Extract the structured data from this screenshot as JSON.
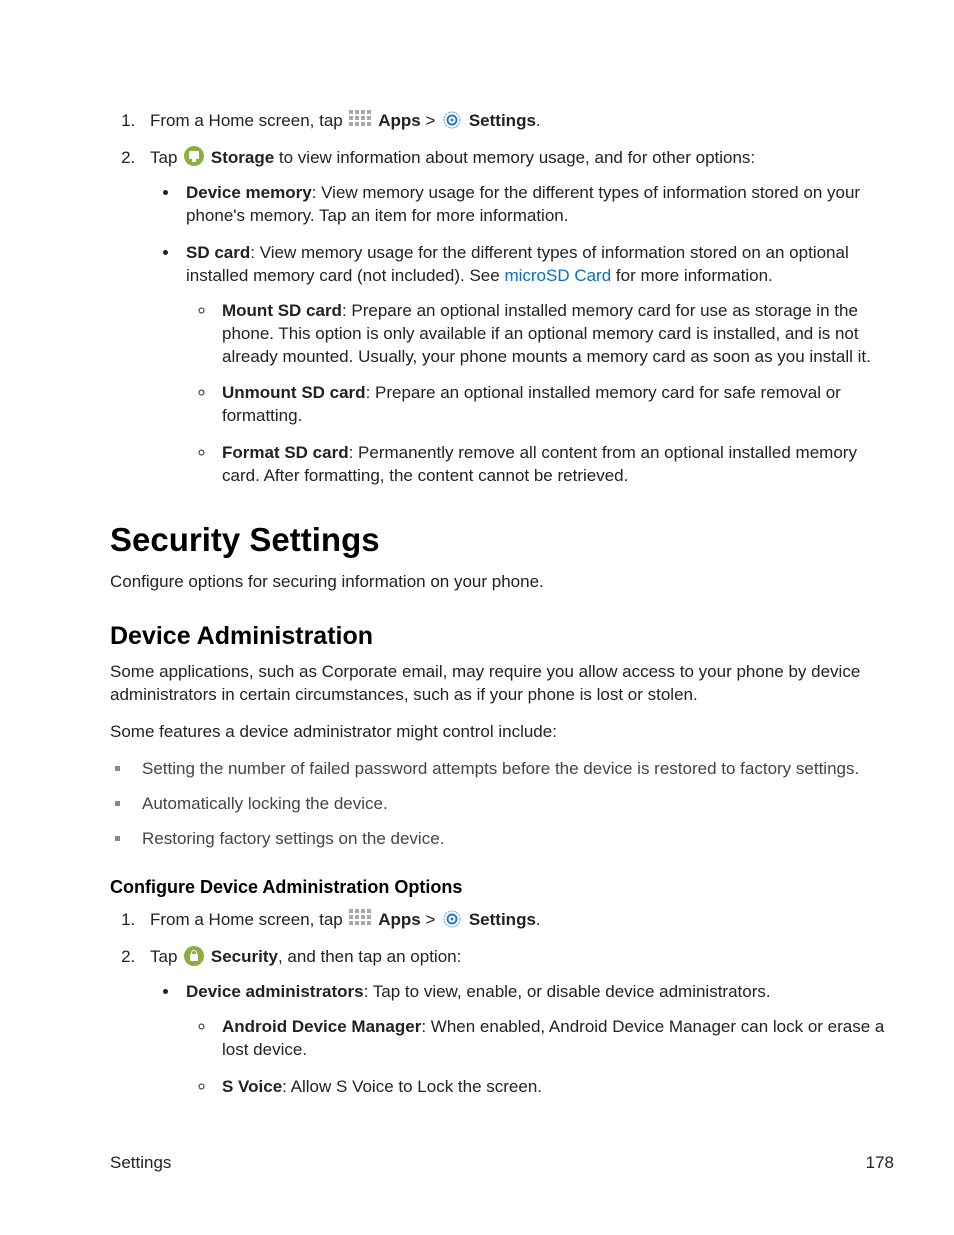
{
  "nav": {
    "from_home_prefix": "From a Home screen, tap",
    "apps_label": "Apps",
    "sep": " > ",
    "settings_label": "Settings",
    "period": "."
  },
  "storage": {
    "tap_prefix": "Tap ",
    "storage_label": "Storage",
    "storage_suffix": " to view information about memory usage, and for other options:",
    "device_memory_b": "Device memory",
    "device_memory_t": ": View memory usage for the different types of information stored on your phone's memory. Tap an item for more information.",
    "sd_card_b": "SD card",
    "sd_card_t1": ": View memory usage for the different types of information stored on an optional installed memory card (not included). See ",
    "sd_card_link": "microSD Card",
    "sd_card_t2": " for more information.",
    "mount_b": "Mount SD card",
    "mount_t": ": Prepare an optional installed memory card for use as storage in the phone. This option is only available if an optional memory card is installed, and is not already mounted. Usually, your phone mounts a memory card as soon as you install it.",
    "unmount_b": "Unmount SD card",
    "unmount_t": ": Prepare an optional installed memory card for safe removal or formatting.",
    "format_b": "Format SD card",
    "format_t": ": Permanently remove all content from an optional installed memory card. After formatting, the content cannot be retrieved."
  },
  "security": {
    "h1": "Security Settings",
    "intro": "Configure options for securing information on your phone.",
    "h2": "Device Administration",
    "p1": "Some applications, such as Corporate email, may require you allow access to your phone by device administrators in certain circumstances, such as if your phone is lost or stolen.",
    "p2": "Some features a device administrator might control include:",
    "sq1": "Setting the number of failed password attempts before the device is restored to factory settings.",
    "sq2": "Automatically locking the device.",
    "sq3": "Restoring factory settings on the device.",
    "h3": "Configure Device Administration Options",
    "step2_prefix": "Tap ",
    "step2_label": "Security",
    "step2_suffix": ", and then tap an option:",
    "da_b": "Device administrators",
    "da_t": ": Tap to view, enable, or disable device administrators.",
    "adm_b": "Android Device Manager",
    "adm_t": ": When enabled, Android Device Manager can lock or erase a lost device.",
    "sv_b": "S Voice",
    "sv_t": ": Allow S Voice to Lock the screen."
  },
  "footer": {
    "left": "Settings",
    "right": "178"
  }
}
